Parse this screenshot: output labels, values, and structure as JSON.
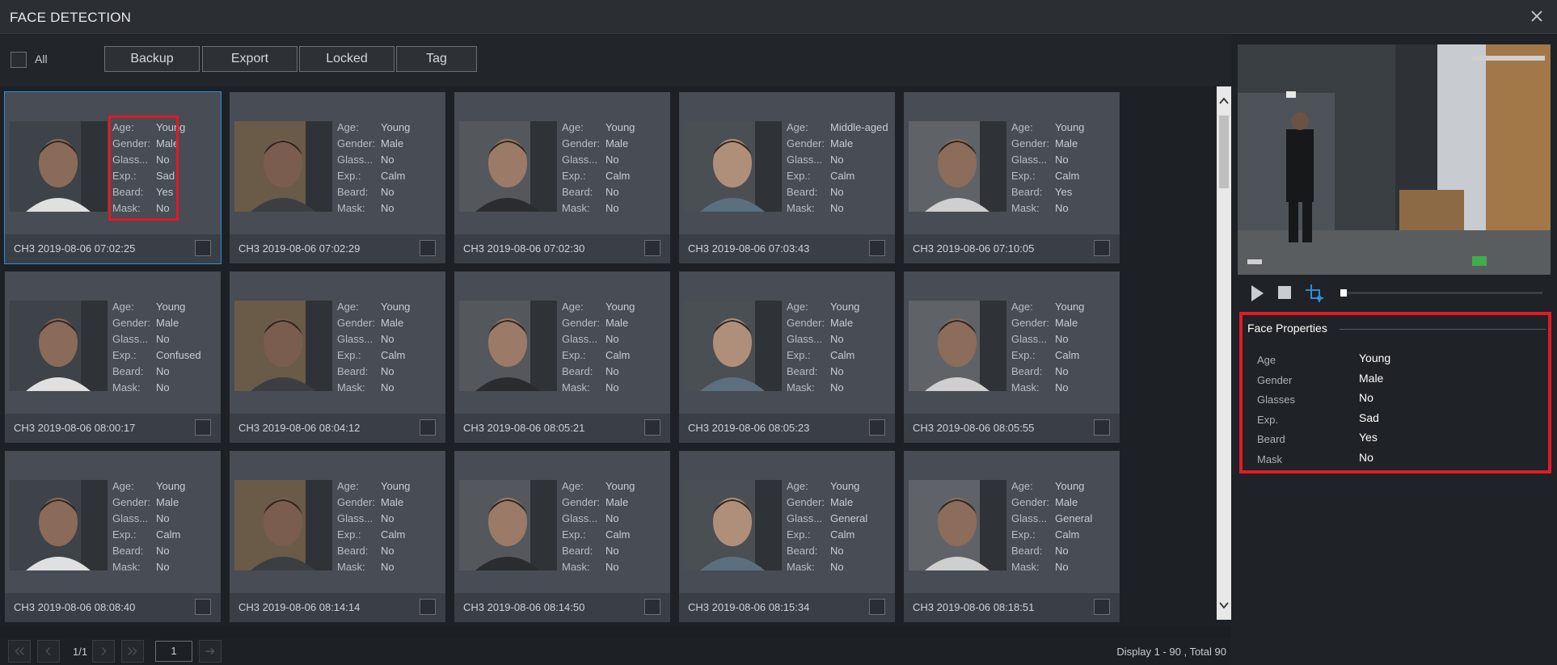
{
  "window": {
    "title": "FACE DETECTION"
  },
  "toolbar": {
    "all_label": "All",
    "buttons": [
      "Backup",
      "Export",
      "Locked",
      "Tag"
    ]
  },
  "attr_labels": [
    "Age:",
    "Gender:",
    "Glass...",
    "Exp.:",
    "Beard:",
    "Mask:"
  ],
  "cards": [
    {
      "time": "CH3 2019-08-06 07:02:25",
      "values": [
        "Young",
        "Male",
        "No",
        "Sad",
        "Yes",
        "No"
      ]
    },
    {
      "time": "CH3 2019-08-06 07:02:29",
      "values": [
        "Young",
        "Male",
        "No",
        "Calm",
        "No",
        "No"
      ]
    },
    {
      "time": "CH3 2019-08-06 07:02:30",
      "values": [
        "Young",
        "Male",
        "No",
        "Calm",
        "No",
        "No"
      ]
    },
    {
      "time": "CH3 2019-08-06 07:03:43",
      "values": [
        "Middle-aged",
        "Male",
        "No",
        "Calm",
        "No",
        "No"
      ]
    },
    {
      "time": "CH3 2019-08-06 07:10:05",
      "values": [
        "Young",
        "Male",
        "No",
        "Calm",
        "Yes",
        "No"
      ]
    },
    {
      "time": "CH3 2019-08-06 08:00:17",
      "values": [
        "Young",
        "Male",
        "No",
        "Confused",
        "No",
        "No"
      ]
    },
    {
      "time": "CH3 2019-08-06 08:04:12",
      "values": [
        "Young",
        "Male",
        "No",
        "Calm",
        "No",
        "No"
      ]
    },
    {
      "time": "CH3 2019-08-06 08:05:21",
      "values": [
        "Young",
        "Male",
        "No",
        "Calm",
        "No",
        "No"
      ]
    },
    {
      "time": "CH3 2019-08-06 08:05:23",
      "values": [
        "Young",
        "Male",
        "No",
        "Calm",
        "No",
        "No"
      ]
    },
    {
      "time": "CH3 2019-08-06 08:05:55",
      "values": [
        "Young",
        "Male",
        "No",
        "Calm",
        "No",
        "No"
      ]
    },
    {
      "time": "CH3 2019-08-06 08:08:40",
      "values": [
        "Young",
        "Male",
        "No",
        "Calm",
        "No",
        "No"
      ]
    },
    {
      "time": "CH3 2019-08-06 08:14:14",
      "values": [
        "Young",
        "Male",
        "No",
        "Calm",
        "No",
        "No"
      ]
    },
    {
      "time": "CH3 2019-08-06 08:14:50",
      "values": [
        "Young",
        "Male",
        "No",
        "Calm",
        "No",
        "No"
      ]
    },
    {
      "time": "CH3 2019-08-06 08:15:34",
      "values": [
        "Young",
        "Male",
        "General",
        "Calm",
        "No",
        "No"
      ]
    },
    {
      "time": "CH3 2019-08-06 08:18:51",
      "values": [
        "Young",
        "Male",
        "General",
        "Calm",
        "No",
        "No"
      ]
    }
  ],
  "pager": {
    "page_info": "1/1",
    "page_input": "1",
    "display": "Display 1 - 90 , Total 90"
  },
  "face_properties": {
    "title": "Face Properties",
    "rows": [
      {
        "label": "Age",
        "value": "Young"
      },
      {
        "label": "Gender",
        "value": "Male"
      },
      {
        "label": "Glasses",
        "value": "No"
      },
      {
        "label": "Exp.",
        "value": "Sad"
      },
      {
        "label": "Beard",
        "value": "Yes"
      },
      {
        "label": "Mask",
        "value": "No"
      }
    ]
  },
  "colors": {
    "highlight": "#e11b24",
    "selected": "#2e8fd6",
    "accent_blue": "#2e8fd6"
  },
  "icons": [
    "close-icon",
    "play-icon",
    "stop-icon",
    "crop-icon",
    "first-page-icon",
    "prev-page-icon",
    "next-page-icon",
    "last-page-icon",
    "go-icon",
    "scroll-up-icon",
    "scroll-down-icon"
  ]
}
